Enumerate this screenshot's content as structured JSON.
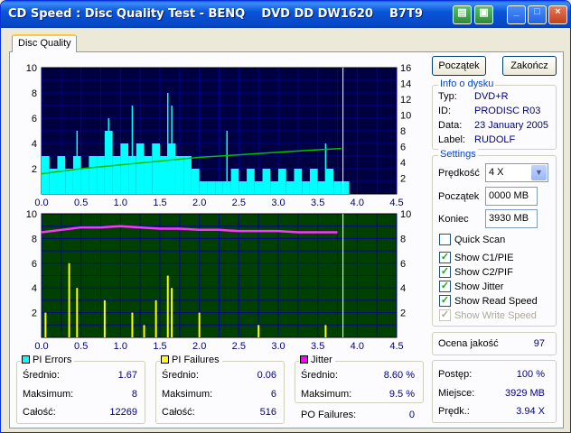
{
  "window": {
    "title": "CD Speed : Disc Quality Test - BENQ    DVD DD DW1620    B7T9",
    "controls": {
      "minimize": "_",
      "maximize": "□",
      "close": "×"
    }
  },
  "tabs": [
    {
      "label": "Disc Quality",
      "active": true
    }
  ],
  "buttons": {
    "start": "Początek",
    "stop": "Zakończ"
  },
  "disc_info": {
    "title": "Info o dysku",
    "rows": [
      {
        "label": "Typ:",
        "value": "DVD+R"
      },
      {
        "label": "ID:",
        "value": "PRODISC R03"
      },
      {
        "label": "Data:",
        "value": "23 January 2005"
      },
      {
        "label": "Label:",
        "value": "RUDOLF"
      }
    ]
  },
  "settings": {
    "title": "Settings",
    "speed_label": "Prędkość",
    "speed_value": "4 X",
    "start_label": "Początek",
    "start_value": "0000 MB",
    "end_label": "Koniec",
    "end_value": "3930 MB",
    "checkboxes": [
      {
        "label": "Quick Scan",
        "checked": false,
        "enabled": true
      },
      {
        "label": "Show C1/PIE",
        "checked": true,
        "enabled": true
      },
      {
        "label": "Show C2/PIF",
        "checked": true,
        "enabled": true
      },
      {
        "label": "Show Jitter",
        "checked": true,
        "enabled": true
      },
      {
        "label": "Show Read Speed",
        "checked": true,
        "enabled": true
      },
      {
        "label": "Show Write Speed",
        "checked": true,
        "enabled": false
      }
    ]
  },
  "quality": {
    "label": "Ocena jakość",
    "value": "97"
  },
  "progress": {
    "rows": [
      {
        "label": "Postęp:",
        "value": "100 %"
      },
      {
        "label": "Miejsce:",
        "value": "3929 MB"
      },
      {
        "label": "Prędk.:",
        "value": "3.94 X"
      }
    ]
  },
  "stats": {
    "pi_errors": {
      "title": "PI Errors",
      "color": "#00ffff",
      "rows": [
        {
          "label": "Średnio:",
          "value": "1.67"
        },
        {
          "label": "Maksimum:",
          "value": "8"
        },
        {
          "label": "Całość:",
          "value": "12269"
        }
      ]
    },
    "pi_failures": {
      "title": "PI Failures",
      "color": "#ffff00",
      "rows": [
        {
          "label": "Średnio:",
          "value": "0.06"
        },
        {
          "label": "Maksimum:",
          "value": "6"
        },
        {
          "label": "Całość:",
          "value": "516"
        }
      ]
    },
    "jitter": {
      "title": "Jitter",
      "color": "#ff00ff",
      "rows": [
        {
          "label": "Średnio:",
          "value": "8.60 %"
        },
        {
          "label": "Maksimum:",
          "value": "9.5 %"
        }
      ]
    },
    "po_failures": {
      "label": "PO Failures:",
      "value": "0"
    }
  },
  "chart_data": [
    {
      "type": "area",
      "name": "PI errors chart",
      "xlim": [
        0,
        4.5
      ],
      "ylim_left": [
        0,
        10
      ],
      "ylim_right": [
        0,
        16
      ],
      "x_ticks": [
        "0.0",
        "0.5",
        "1.0",
        "1.5",
        "2.0",
        "2.5",
        "3.0",
        "3.5",
        "4.0",
        "4.5"
      ],
      "y_ticks_left": [
        "2",
        "4",
        "6",
        "8",
        "10"
      ],
      "y_ticks_right": [
        "2",
        "4",
        "6",
        "8",
        "10",
        "12",
        "14",
        "16"
      ],
      "background": "#000040",
      "grid": true,
      "series": [
        {
          "name": "PI Errors",
          "color": "#00ffff",
          "x": [
            0.0,
            0.1,
            0.2,
            0.3,
            0.4,
            0.5,
            0.6,
            0.7,
            0.8,
            0.9,
            1.0,
            1.1,
            1.2,
            1.3,
            1.4,
            1.5,
            1.6,
            1.7,
            1.8,
            1.9,
            2.0,
            2.1,
            2.2,
            2.3,
            2.4,
            2.5,
            2.6,
            2.7,
            2.8,
            2.9,
            3.0,
            3.1,
            3.2,
            3.3,
            3.4,
            3.5,
            3.6,
            3.7,
            3.8
          ],
          "y": [
            3,
            2,
            3,
            2,
            3,
            2,
            3,
            3,
            5,
            3,
            4,
            3,
            4,
            3,
            4,
            3,
            4,
            3,
            3,
            2,
            1,
            1,
            1,
            1,
            2,
            1,
            2,
            1,
            2,
            1,
            2,
            1,
            2,
            1,
            2,
            1,
            2,
            1,
            1
          ],
          "max_spikes": [
            {
              "x": 0.45,
              "y": 5
            },
            {
              "x": 0.85,
              "y": 6
            },
            {
              "x": 1.15,
              "y": 7
            },
            {
              "x": 1.6,
              "y": 8
            },
            {
              "x": 1.65,
              "y": 7
            },
            {
              "x": 2.35,
              "y": 5
            },
            {
              "x": 3.6,
              "y": 4
            }
          ]
        },
        {
          "name": "Read Speed",
          "color": "#00c000",
          "x": [
            0.0,
            0.5,
            1.0,
            1.5,
            2.0,
            2.5,
            3.0,
            3.5,
            3.8
          ],
          "y": [
            1.6,
            2.0,
            2.3,
            2.6,
            2.9,
            3.1,
            3.3,
            3.5,
            3.6
          ]
        }
      ]
    },
    {
      "type": "bar",
      "name": "PI failures / jitter chart",
      "xlim": [
        0,
        4.5
      ],
      "ylim_left": [
        0,
        10
      ],
      "ylim_right": [
        0,
        10
      ],
      "x_ticks": [
        "0.0",
        "0.5",
        "1.0",
        "1.5",
        "2.0",
        "2.5",
        "3.0",
        "3.5",
        "4.0",
        "4.5"
      ],
      "y_ticks_left": [
        "2",
        "4",
        "6",
        "8",
        "10"
      ],
      "y_ticks_right": [
        "2",
        "4",
        "6",
        "8",
        "10"
      ],
      "background": "#004000",
      "grid": true,
      "series": [
        {
          "name": "PI Failures",
          "color": "#ffff00",
          "x": [
            0.05,
            0.35,
            0.45,
            0.8,
            1.15,
            1.3,
            1.45,
            1.6,
            1.65,
            2.0,
            2.75,
            3.6
          ],
          "y": [
            2,
            6,
            4,
            3,
            2,
            1,
            3,
            5,
            4,
            2,
            1,
            1
          ]
        },
        {
          "name": "Jitter",
          "color": "#ff33ff",
          "x": [
            0.0,
            0.25,
            0.5,
            0.75,
            1.0,
            1.25,
            1.5,
            1.75,
            2.0,
            2.25,
            2.5,
            2.75,
            3.0,
            3.25,
            3.5,
            3.75
          ],
          "y": [
            8.5,
            8.7,
            8.9,
            8.9,
            9.0,
            8.9,
            8.8,
            8.8,
            8.7,
            8.7,
            8.6,
            8.6,
            8.6,
            8.5,
            8.5,
            8.5
          ]
        }
      ]
    }
  ]
}
